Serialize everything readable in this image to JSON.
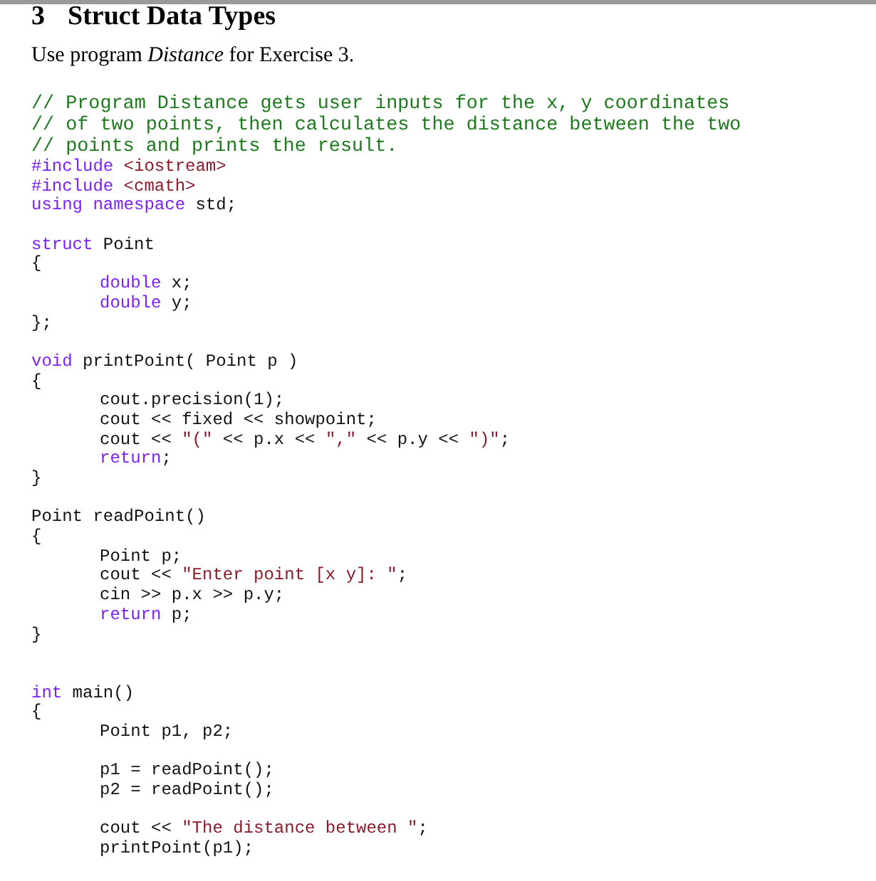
{
  "heading": {
    "number": "3",
    "title": "Struct Data Types"
  },
  "intro": "Use program *Distance* for Exercise 3.",
  "code": [
    {
      "kind": "comment",
      "tokens": [
        {
          "kind": "comment",
          "text": "// Program Distance gets user inputs for the x, y coordinates"
        }
      ]
    },
    {
      "kind": "comment",
      "tokens": [
        {
          "kind": "comment",
          "text": "// of two points, then calculates the distance between the two"
        }
      ]
    },
    {
      "kind": "comment",
      "tokens": [
        {
          "kind": "comment",
          "text": "// points and prints the result."
        }
      ]
    },
    {
      "kind": "code",
      "tokens": [
        {
          "kind": "keyword",
          "text": "#include"
        },
        {
          "kind": "string",
          "text": " <iostream>"
        }
      ]
    },
    {
      "kind": "code",
      "tokens": [
        {
          "kind": "keyword",
          "text": "#include"
        },
        {
          "kind": "string",
          "text": " <cmath>"
        }
      ]
    },
    {
      "kind": "code",
      "tokens": [
        {
          "kind": "keyword",
          "text": "using namespace"
        },
        {
          "kind": "plain",
          "text": " std;"
        }
      ]
    },
    {
      "kind": "blank"
    },
    {
      "kind": "code",
      "tokens": [
        {
          "kind": "keyword",
          "text": "struct"
        },
        {
          "kind": "plain",
          "text": " Point"
        }
      ]
    },
    {
      "kind": "code",
      "tokens": [
        {
          "kind": "plain",
          "text": "{"
        }
      ]
    },
    {
      "kind": "code",
      "tokens": [
        {
          "kind": "keyword",
          "text": "\tdouble"
        },
        {
          "kind": "plain",
          "text": " x;"
        }
      ]
    },
    {
      "kind": "code",
      "tokens": [
        {
          "kind": "keyword",
          "text": "\tdouble"
        },
        {
          "kind": "plain",
          "text": " y;"
        }
      ]
    },
    {
      "kind": "code",
      "tokens": [
        {
          "kind": "plain",
          "text": "};"
        }
      ]
    },
    {
      "kind": "blank"
    },
    {
      "kind": "code",
      "tokens": [
        {
          "kind": "keyword",
          "text": "void"
        },
        {
          "kind": "plain",
          "text": " printPoint( Point p )"
        }
      ]
    },
    {
      "kind": "code",
      "tokens": [
        {
          "kind": "plain",
          "text": "{"
        }
      ]
    },
    {
      "kind": "code",
      "tokens": [
        {
          "kind": "plain",
          "text": "\tcout.precision(1);"
        }
      ]
    },
    {
      "kind": "code",
      "tokens": [
        {
          "kind": "plain",
          "text": "\tcout << fixed << showpoint;"
        }
      ]
    },
    {
      "kind": "code",
      "tokens": [
        {
          "kind": "plain",
          "text": "\tcout << "
        },
        {
          "kind": "string",
          "text": "\"(\""
        },
        {
          "kind": "plain",
          "text": " << p.x << "
        },
        {
          "kind": "string",
          "text": "\",\""
        },
        {
          "kind": "plain",
          "text": " << p.y << "
        },
        {
          "kind": "string",
          "text": "\")\""
        },
        {
          "kind": "plain",
          "text": ";"
        }
      ]
    },
    {
      "kind": "code",
      "tokens": [
        {
          "kind": "keyword",
          "text": "\treturn"
        },
        {
          "kind": "plain",
          "text": ";"
        }
      ]
    },
    {
      "kind": "code",
      "tokens": [
        {
          "kind": "plain",
          "text": "}"
        }
      ]
    },
    {
      "kind": "blank"
    },
    {
      "kind": "code",
      "tokens": [
        {
          "kind": "plain",
          "text": "Point readPoint()"
        }
      ]
    },
    {
      "kind": "code",
      "tokens": [
        {
          "kind": "plain",
          "text": "{"
        }
      ]
    },
    {
      "kind": "code",
      "tokens": [
        {
          "kind": "plain",
          "text": "\tPoint p;"
        }
      ]
    },
    {
      "kind": "code",
      "tokens": [
        {
          "kind": "plain",
          "text": "\tcout << "
        },
        {
          "kind": "string",
          "text": "\"Enter point [x y]: \""
        },
        {
          "kind": "plain",
          "text": ";"
        }
      ]
    },
    {
      "kind": "code",
      "tokens": [
        {
          "kind": "plain",
          "text": "\tcin >> p.x >> p.y;"
        }
      ]
    },
    {
      "kind": "code",
      "tokens": [
        {
          "kind": "keyword",
          "text": "\treturn"
        },
        {
          "kind": "plain",
          "text": " p;"
        }
      ]
    },
    {
      "kind": "code",
      "tokens": [
        {
          "kind": "plain",
          "text": "}"
        }
      ]
    },
    {
      "kind": "blank"
    },
    {
      "kind": "blank"
    },
    {
      "kind": "code",
      "tokens": [
        {
          "kind": "keyword",
          "text": "int"
        },
        {
          "kind": "plain",
          "text": " main()"
        }
      ]
    },
    {
      "kind": "code",
      "tokens": [
        {
          "kind": "plain",
          "text": "{"
        }
      ]
    },
    {
      "kind": "code",
      "tokens": [
        {
          "kind": "plain",
          "text": "\tPoint p1, p2;"
        }
      ]
    },
    {
      "kind": "blank"
    },
    {
      "kind": "code",
      "tokens": [
        {
          "kind": "plain",
          "text": "\tp1 = readPoint();"
        }
      ]
    },
    {
      "kind": "code",
      "tokens": [
        {
          "kind": "plain",
          "text": "\tp2 = readPoint();"
        }
      ]
    },
    {
      "kind": "blank"
    },
    {
      "kind": "code",
      "tokens": [
        {
          "kind": "plain",
          "text": "\tcout << "
        },
        {
          "kind": "string",
          "text": "\"The distance between \""
        },
        {
          "kind": "plain",
          "text": ";"
        }
      ]
    },
    {
      "kind": "code",
      "tokens": [
        {
          "kind": "plain",
          "text": "\tprintPoint(p1);"
        }
      ]
    }
  ]
}
